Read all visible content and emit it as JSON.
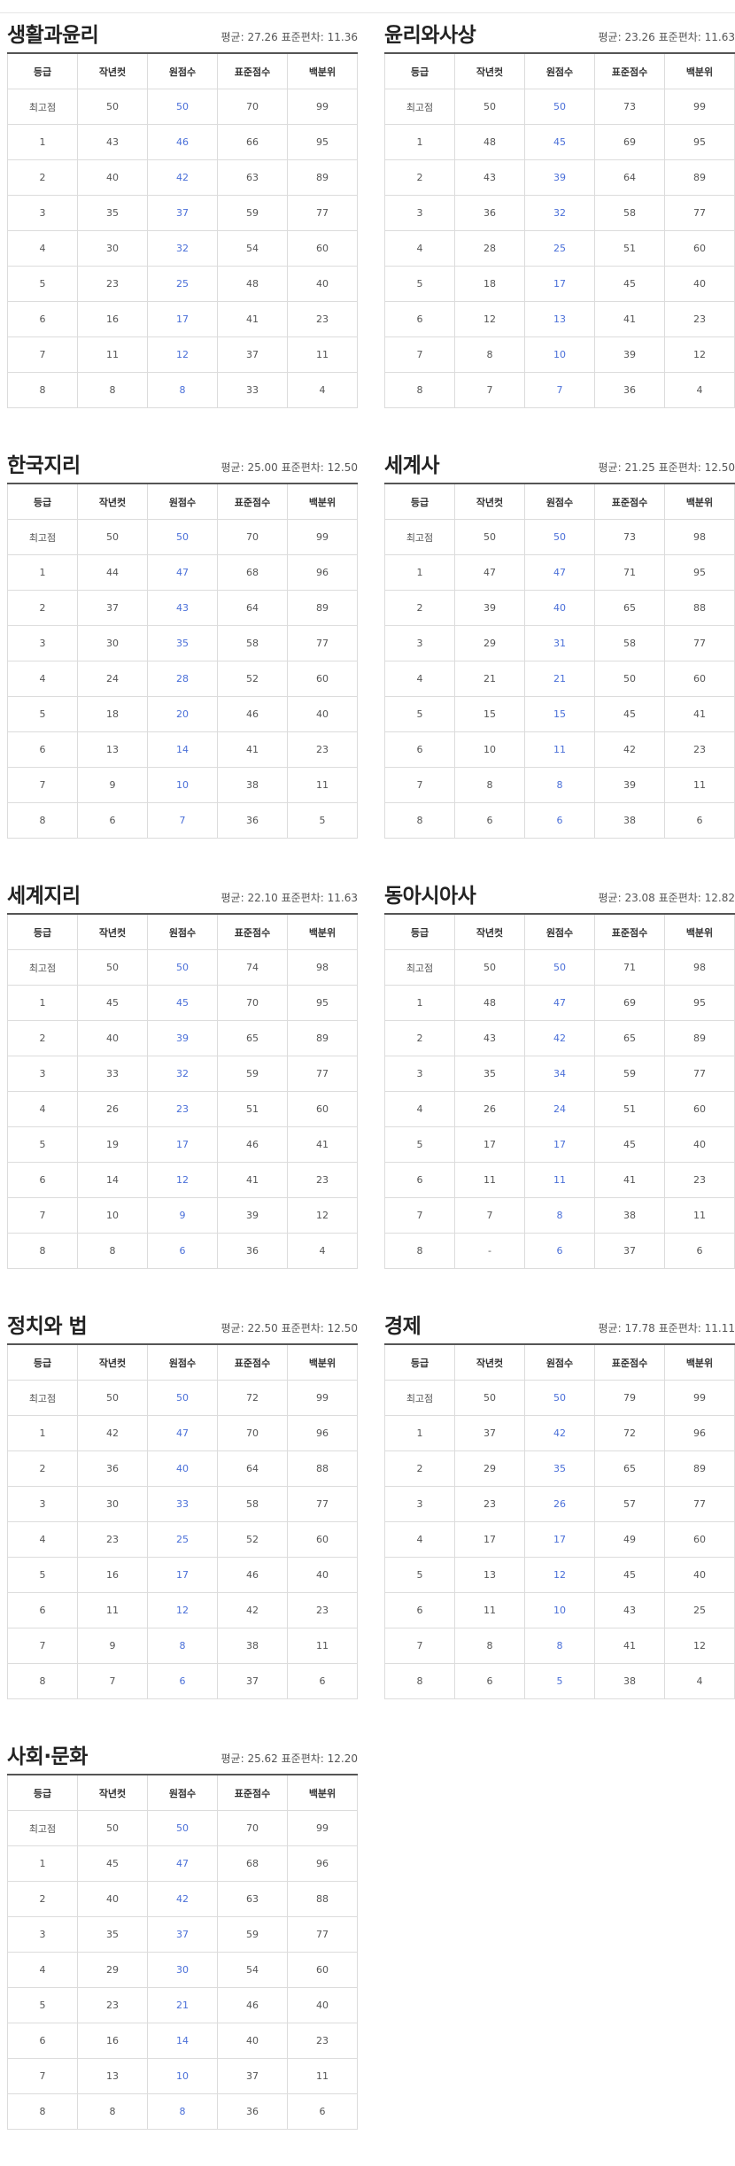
{
  "headers": [
    "등급",
    "작년컷",
    "원점수",
    "표준점수",
    "백분위"
  ],
  "colors": {
    "raw_score": "#4a6fd8",
    "header_border": "#555555",
    "cell_border": "#dcdcdc"
  },
  "panels": [
    {
      "title": "생활과윤리",
      "stats": "평균: 27.26 표준편차: 11.36",
      "rows": [
        [
          "최고점",
          "50",
          "50",
          "70",
          "99"
        ],
        [
          "1",
          "43",
          "46",
          "66",
          "95"
        ],
        [
          "2",
          "40",
          "42",
          "63",
          "89"
        ],
        [
          "3",
          "35",
          "37",
          "59",
          "77"
        ],
        [
          "4",
          "30",
          "32",
          "54",
          "60"
        ],
        [
          "5",
          "23",
          "25",
          "48",
          "40"
        ],
        [
          "6",
          "16",
          "17",
          "41",
          "23"
        ],
        [
          "7",
          "11",
          "12",
          "37",
          "11"
        ],
        [
          "8",
          "8",
          "8",
          "33",
          "4"
        ]
      ]
    },
    {
      "title": "윤리와사상",
      "stats": "평균: 23.26 표준편차: 11.63",
      "rows": [
        [
          "최고점",
          "50",
          "50",
          "73",
          "99"
        ],
        [
          "1",
          "48",
          "45",
          "69",
          "95"
        ],
        [
          "2",
          "43",
          "39",
          "64",
          "89"
        ],
        [
          "3",
          "36",
          "32",
          "58",
          "77"
        ],
        [
          "4",
          "28",
          "25",
          "51",
          "60"
        ],
        [
          "5",
          "18",
          "17",
          "45",
          "40"
        ],
        [
          "6",
          "12",
          "13",
          "41",
          "23"
        ],
        [
          "7",
          "8",
          "10",
          "39",
          "12"
        ],
        [
          "8",
          "7",
          "7",
          "36",
          "4"
        ]
      ]
    },
    {
      "title": "한국지리",
      "stats": "평균: 25.00 표준편차: 12.50",
      "rows": [
        [
          "최고점",
          "50",
          "50",
          "70",
          "99"
        ],
        [
          "1",
          "44",
          "47",
          "68",
          "96"
        ],
        [
          "2",
          "37",
          "43",
          "64",
          "89"
        ],
        [
          "3",
          "30",
          "35",
          "58",
          "77"
        ],
        [
          "4",
          "24",
          "28",
          "52",
          "60"
        ],
        [
          "5",
          "18",
          "20",
          "46",
          "40"
        ],
        [
          "6",
          "13",
          "14",
          "41",
          "23"
        ],
        [
          "7",
          "9",
          "10",
          "38",
          "11"
        ],
        [
          "8",
          "6",
          "7",
          "36",
          "5"
        ]
      ]
    },
    {
      "title": "세계사",
      "stats": "평균: 21.25 표준편차: 12.50",
      "rows": [
        [
          "최고점",
          "50",
          "50",
          "73",
          "98"
        ],
        [
          "1",
          "47",
          "47",
          "71",
          "95"
        ],
        [
          "2",
          "39",
          "40",
          "65",
          "88"
        ],
        [
          "3",
          "29",
          "31",
          "58",
          "77"
        ],
        [
          "4",
          "21",
          "21",
          "50",
          "60"
        ],
        [
          "5",
          "15",
          "15",
          "45",
          "41"
        ],
        [
          "6",
          "10",
          "11",
          "42",
          "23"
        ],
        [
          "7",
          "8",
          "8",
          "39",
          "11"
        ],
        [
          "8",
          "6",
          "6",
          "38",
          "6"
        ]
      ]
    },
    {
      "title": "세계지리",
      "stats": "평균: 22.10 표준편차: 11.63",
      "rows": [
        [
          "최고점",
          "50",
          "50",
          "74",
          "98"
        ],
        [
          "1",
          "45",
          "45",
          "70",
          "95"
        ],
        [
          "2",
          "40",
          "39",
          "65",
          "89"
        ],
        [
          "3",
          "33",
          "32",
          "59",
          "77"
        ],
        [
          "4",
          "26",
          "23",
          "51",
          "60"
        ],
        [
          "5",
          "19",
          "17",
          "46",
          "41"
        ],
        [
          "6",
          "14",
          "12",
          "41",
          "23"
        ],
        [
          "7",
          "10",
          "9",
          "39",
          "12"
        ],
        [
          "8",
          "8",
          "6",
          "36",
          "4"
        ]
      ]
    },
    {
      "title": "동아시아사",
      "stats": "평균: 23.08 표준편차: 12.82",
      "rows": [
        [
          "최고점",
          "50",
          "50",
          "71",
          "98"
        ],
        [
          "1",
          "48",
          "47",
          "69",
          "95"
        ],
        [
          "2",
          "43",
          "42",
          "65",
          "89"
        ],
        [
          "3",
          "35",
          "34",
          "59",
          "77"
        ],
        [
          "4",
          "26",
          "24",
          "51",
          "60"
        ],
        [
          "5",
          "17",
          "17",
          "45",
          "40"
        ],
        [
          "6",
          "11",
          "11",
          "41",
          "23"
        ],
        [
          "7",
          "7",
          "8",
          "38",
          "11"
        ],
        [
          "8",
          "-",
          "6",
          "37",
          "6"
        ]
      ]
    },
    {
      "title": "정치와 법",
      "stats": "평균: 22.50 표준편차: 12.50",
      "rows": [
        [
          "최고점",
          "50",
          "50",
          "72",
          "99"
        ],
        [
          "1",
          "42",
          "47",
          "70",
          "96"
        ],
        [
          "2",
          "36",
          "40",
          "64",
          "88"
        ],
        [
          "3",
          "30",
          "33",
          "58",
          "77"
        ],
        [
          "4",
          "23",
          "25",
          "52",
          "60"
        ],
        [
          "5",
          "16",
          "17",
          "46",
          "40"
        ],
        [
          "6",
          "11",
          "12",
          "42",
          "23"
        ],
        [
          "7",
          "9",
          "8",
          "38",
          "11"
        ],
        [
          "8",
          "7",
          "6",
          "37",
          "6"
        ]
      ]
    },
    {
      "title": "경제",
      "stats": "평균: 17.78 표준편차: 11.11",
      "rows": [
        [
          "최고점",
          "50",
          "50",
          "79",
          "99"
        ],
        [
          "1",
          "37",
          "42",
          "72",
          "96"
        ],
        [
          "2",
          "29",
          "35",
          "65",
          "89"
        ],
        [
          "3",
          "23",
          "26",
          "57",
          "77"
        ],
        [
          "4",
          "17",
          "17",
          "49",
          "60"
        ],
        [
          "5",
          "13",
          "12",
          "45",
          "40"
        ],
        [
          "6",
          "11",
          "10",
          "43",
          "25"
        ],
        [
          "7",
          "8",
          "8",
          "41",
          "12"
        ],
        [
          "8",
          "6",
          "5",
          "38",
          "4"
        ]
      ]
    },
    {
      "title": "사회·문화",
      "stats": "평균: 25.62 표준편차: 12.20",
      "rows": [
        [
          "최고점",
          "50",
          "50",
          "70",
          "99"
        ],
        [
          "1",
          "45",
          "47",
          "68",
          "96"
        ],
        [
          "2",
          "40",
          "42",
          "63",
          "88"
        ],
        [
          "3",
          "35",
          "37",
          "59",
          "77"
        ],
        [
          "4",
          "29",
          "30",
          "54",
          "60"
        ],
        [
          "5",
          "23",
          "21",
          "46",
          "40"
        ],
        [
          "6",
          "16",
          "14",
          "40",
          "23"
        ],
        [
          "7",
          "13",
          "10",
          "37",
          "11"
        ],
        [
          "8",
          "8",
          "8",
          "36",
          "6"
        ]
      ]
    }
  ]
}
